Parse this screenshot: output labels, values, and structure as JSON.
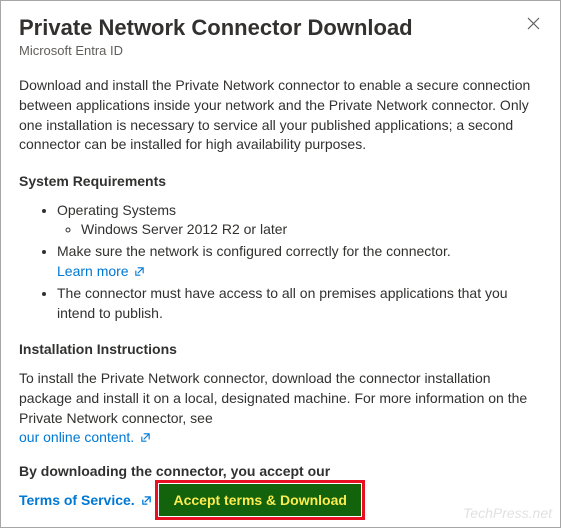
{
  "header": {
    "title": "Private Network Connector Download",
    "subtitle": "Microsoft Entra ID"
  },
  "intro": "Download and install the Private Network connector to enable a secure connection between applications inside your network and the Private Network connector. Only one installation is necessary to service all your published applications; a second connector can be installed for high availability purposes.",
  "sys_req": {
    "heading": "System Requirements",
    "os_label": "Operating Systems",
    "os_value": "Windows Server 2012 R2 or later",
    "net_text": "Make sure the network is configured correctly for the connector.",
    "learn_more": "Learn more",
    "access_text": "The connector must have access to all on premises applications that you intend to publish."
  },
  "install": {
    "heading": "Installation Instructions",
    "para": "To install the Private Network connector, download the connector installation package and install it on a local, designated machine. For more information on the Private Network connector, see",
    "link_text": "our online content."
  },
  "accept": {
    "heading": "By downloading the connector, you accept our",
    "tos": "Terms of Service."
  },
  "button": {
    "label": "Accept terms & Download"
  },
  "watermark": "TechPress.net"
}
